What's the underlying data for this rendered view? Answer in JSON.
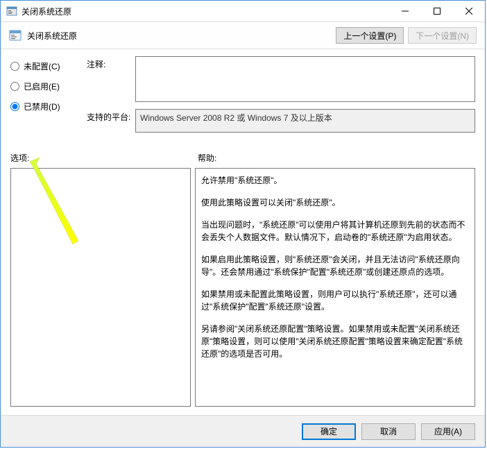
{
  "window": {
    "title": "关闭系统还原"
  },
  "header": {
    "title": "关闭系统还原",
    "prev_button": "上一个设置(P)",
    "next_button": "下一个设置(N)"
  },
  "radios": {
    "not_configured": "未配置(C)",
    "enabled": "已启用(E)",
    "disabled": "已禁用(D)",
    "selected": "disabled"
  },
  "fields": {
    "comment_label": "注释:",
    "comment_value": "",
    "platform_label": "支持的平台:",
    "platform_value": "Windows Server 2008 R2 或 Windows 7 及以上版本"
  },
  "panes": {
    "options_label": "选项:",
    "help_label": "帮助:",
    "help_paragraphs": [
      "允许禁用\"系统还原\"。",
      "使用此策略设置可以关闭\"系统还原\"。",
      "当出现问题时，\"系统还原\"可以使用户将其计算机还原到先前的状态而不会丢失个人数据文件。默认情况下，启动卷的\"系统还原\"为启用状态。",
      "如果启用此策略设置，则\"系统还原\"会关闭，并且无法访问\"系统还原向导\"。还会禁用通过\"系统保护\"配置\"系统还原\"或创建还原点的选项。",
      "如果禁用或未配置此策略设置，则用户可以执行\"系统还原\"，还可以通过\"系统保护\"配置\"系统还原\"设置。",
      "另请参阅\"关闭系统还原配置\"策略设置。如果禁用或未配置\"关闭系统还原\"策略设置，则可以使用\"关闭系统还原配置\"策略设置来确定配置\"系统还原\"的选项是否可用。"
    ]
  },
  "footer": {
    "ok": "确定",
    "cancel": "取消",
    "apply": "应用(A)"
  }
}
